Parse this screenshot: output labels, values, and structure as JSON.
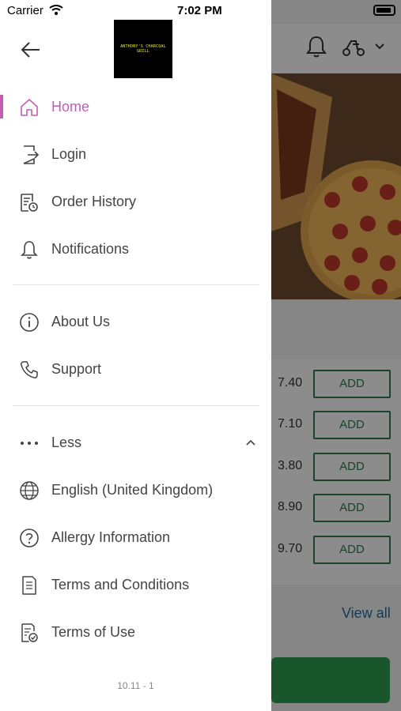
{
  "status_bar": {
    "carrier": "Carrier",
    "time": "7:02 PM"
  },
  "drawer": {
    "logo_text": "ANTHONY'S CHARCOAL GRILL",
    "nav_primary": [
      {
        "label": "Home",
        "icon": "home-icon",
        "active": true
      },
      {
        "label": "Login",
        "icon": "login-icon"
      },
      {
        "label": "Order History",
        "icon": "order-history-icon"
      },
      {
        "label": "Notifications",
        "icon": "bell-icon"
      }
    ],
    "nav_secondary": [
      {
        "label": "About Us",
        "icon": "info-icon"
      },
      {
        "label": "Support",
        "icon": "phone-icon"
      }
    ],
    "less_label": "Less",
    "nav_more": [
      {
        "label": "English (United Kingdom)",
        "icon": "globe-icon"
      },
      {
        "label": "Allergy Information",
        "icon": "question-icon"
      },
      {
        "label": "Terms and Conditions",
        "icon": "document-icon"
      },
      {
        "label": "Terms of Use",
        "icon": "document-check-icon"
      }
    ],
    "version": "10.11 - 1",
    "accent_color": "#c45cb6"
  },
  "background": {
    "menu_items": [
      {
        "price": "7.40",
        "button": "ADD"
      },
      {
        "price": "7.10",
        "button": "ADD"
      },
      {
        "price": "3.80",
        "button": "ADD"
      },
      {
        "price": "8.90",
        "button": "ADD"
      },
      {
        "price": "9.70",
        "button": "ADD"
      }
    ],
    "view_all": "View all",
    "add_color": "#2e7d4f"
  }
}
